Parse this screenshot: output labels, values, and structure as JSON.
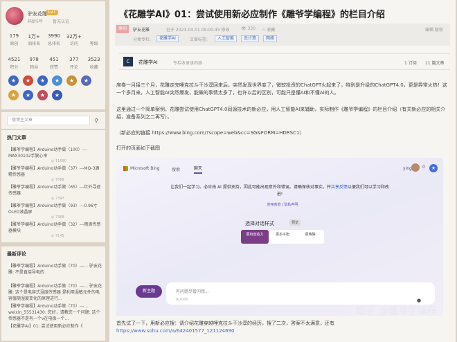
{
  "profile": {
    "username": "驴友花雕",
    "level_badge": "Lv7",
    "years": "码龄5年",
    "cert": "暂无认证",
    "stats_row1": [
      {
        "n": "179",
        "l": "原创"
      },
      {
        "n": "1万+",
        "l": "周排名"
      },
      {
        "n": "3990",
        "l": "总排名"
      },
      {
        "n": "32万+",
        "l": "访问"
      },
      {
        "n": "",
        "l": "等级"
      }
    ],
    "stats_row2": [
      {
        "n": "4521",
        "l": "积分"
      },
      {
        "n": "978",
        "l": "粉丝"
      },
      {
        "n": "451",
        "l": "获赞"
      },
      {
        "n": "377",
        "l": "评论"
      },
      {
        "n": "3523",
        "l": "收藏"
      }
    ],
    "badge_colors": [
      "#3d66c7",
      "#d24a3a",
      "#3d66c7",
      "#4c8fd6",
      "#c8913a",
      "#5a6ab8",
      "#d8a63a",
      "#3d66c7",
      "#c24a5a",
      "#3a5ab8"
    ]
  },
  "search": {
    "placeholder": "搜博主文章"
  },
  "hot": {
    "title": "热门文章",
    "items": [
      {
        "t": "【雕爷学编程】Arduino动手做（100）---MAX30102手腕心率",
        "v": "11690"
      },
      {
        "t": "【雕爷学编程】Arduino动手做（37）---MQ-3酒精传感器",
        "v": "7568"
      },
      {
        "t": "【雕爷学编程】Arduino动手做（65）---红外寻迹传感器",
        "v": "7397"
      },
      {
        "t": "【雕爷学编程】Arduino动手做（93）---0.96寸OLED液晶屏",
        "v": "7368"
      },
      {
        "t": "【雕爷学编程】Arduino动手做（32）---雨滴传感器模块",
        "v": "7145"
      }
    ]
  },
  "recent": {
    "title": "最新评论",
    "items": [
      "【雕爷学编程】Arduino动手做（70）---... 驴友花雕: 不是直接导电的",
      "【雕爷学编程】Arduino动手做（70）---... 驴友花雕: 这个是电容式湿度传感器 是利用湿敏元件的电容值随湿度变化的原理进行...",
      "【雕爷学编程】Arduino动手做（70）---... weixin_55531430: 您好，请教您一个问题: 这个传感器不是有一个v在电极一个...",
      "【花雕学AI】01: 尝试使用新必应制作《"
    ]
  },
  "article": {
    "title": "《花雕学AI》01：尝试使用新必应制作《雕爷学编程》的栏目介绍",
    "orig_badge": "原创",
    "author": "驴友花雕",
    "time": "已于 2023-04-01 09:00:45 修改",
    "views": "350",
    "fav": "收藏",
    "edit": "编辑 版权",
    "column_label": "分类专栏:",
    "column_tag": "花雕学AI",
    "tags_label": "文章标签:",
    "tags": [
      "人工智能",
      "云计算",
      "网络"
    ],
    "col_icon": "C",
    "col_name": "花雕学AI",
    "col_desc": "专栏收录该内容",
    "col_articles": "1 订阅",
    "col_count": "11 篇文章",
    "p1": "席卷一月接三个月，花雕走完哩克拉斗干沙漠回来后，突然发现世界变了，微软投资的ChatGPT火起来了，特别是升级的ChatGPT4.0，更是异常火热！这一个多月来，人工智能AI突然爆发，能做的事情太多了，也许以后的区别，可能只是懂AI和不懂AI的人。",
    "p2": "这里通过一个简单案例，花雕尝试使用ChatGPT4.0同源技术的新必应，用人工智能AI来辅助，实际制作《雕爷学编程》的栏目介绍（有关新必应的相关介绍，准备系列之二再写）。",
    "p3": "（新必应的链接 https://www.bing.com/?scope=web&cc=SG&FORM=HDRSC1）",
    "p4": "打开的页面如下截图",
    "bottom1": "首先试了一下，用新必应搜：请介绍花雕穿越哩克拉斗干沙漠的经历，搜了二次，答案不太满意，还有",
    "bottom_link": "https://www.sohu.com/a/642401577_121124690"
  },
  "bing": {
    "logo": "Microsoft Bing",
    "search": "搜索",
    "chat": "聊天",
    "user": "ying",
    "rewards": "0",
    "welcome": "让我们一起学习。必应由 AI 提供支持，因此可能出现意外和错误。请确保核对事实，并",
    "welcome_link": "共享反馈",
    "welcome_end": "以便我们可以学习和改进!",
    "terms": "使用条款 | 隐私声明",
    "styles_title": "选择对话样式",
    "preview": "预览",
    "styles": [
      "更有创造力",
      "更多平衡",
      "更精确"
    ],
    "new_topic": "新主题",
    "input_ph": "有问题尽管问我...",
    "counter": "0/2000",
    "watermark": "知乎 @雕爷学编程"
  }
}
